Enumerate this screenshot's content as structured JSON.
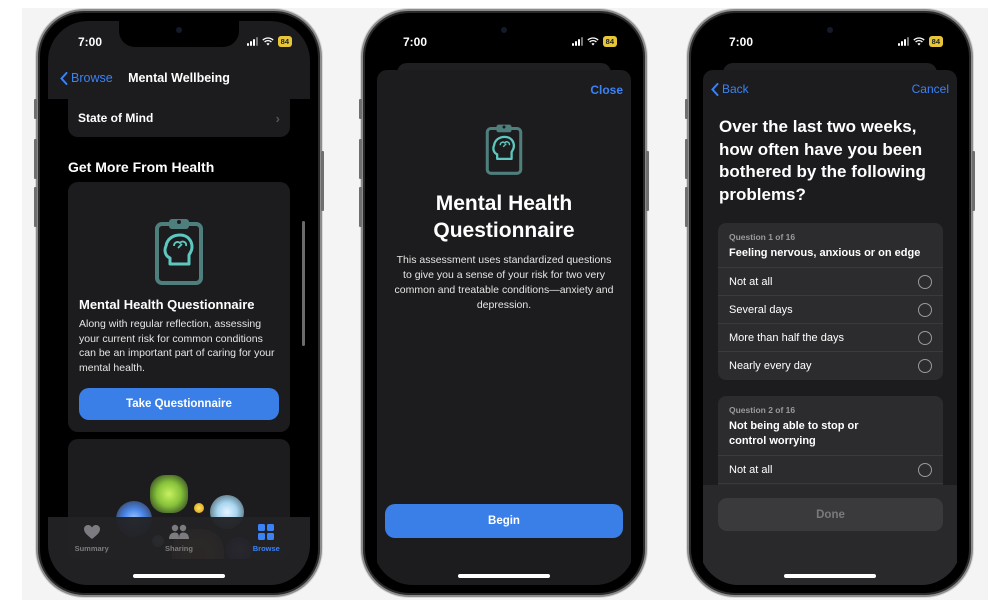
{
  "status_bar": {
    "time": "7:00",
    "battery": "84"
  },
  "phone1": {
    "nav": {
      "back_label": "Browse",
      "title": "Mental Wellbeing"
    },
    "list_row": {
      "label": "State of Mind"
    },
    "section_heading": "Get More From Health",
    "card": {
      "title": "Mental Health Questionnaire",
      "description": "Along with regular reflection, assessing your current risk for common conditions can be an important part of caring for your mental health.",
      "button_label": "Take Questionnaire"
    },
    "tabs": [
      {
        "label": "Summary",
        "icon": "heart-icon",
        "active": false
      },
      {
        "label": "Sharing",
        "icon": "people-icon",
        "active": false
      },
      {
        "label": "Browse",
        "icon": "grid-icon",
        "active": true
      }
    ]
  },
  "phone2": {
    "close_label": "Close",
    "title": "Mental Health Questionnaire",
    "description": "This assessment uses standardized questions to give you a sense of your risk for two very common and treatable conditions—anxiety and depression.",
    "begin_label": "Begin"
  },
  "phone3": {
    "back_label": "Back",
    "cancel_label": "Cancel",
    "heading": "Over the last two weeks, how often have you been bothered by the following problems?",
    "questions": [
      {
        "number": "Question 1 of 16",
        "text": "Feeling nervous, anxious or on edge",
        "options": [
          "Not at all",
          "Several days",
          "More than half the days",
          "Nearly every day"
        ]
      },
      {
        "number": "Question 2 of 16",
        "text": "Not being able to stop or control worrying",
        "options": [
          "Not at all"
        ]
      }
    ],
    "done_label": "Done"
  },
  "colors": {
    "accent": "#3a7fe8",
    "icon_teal": "#5ec8c0",
    "battery": "#e8c63a"
  }
}
